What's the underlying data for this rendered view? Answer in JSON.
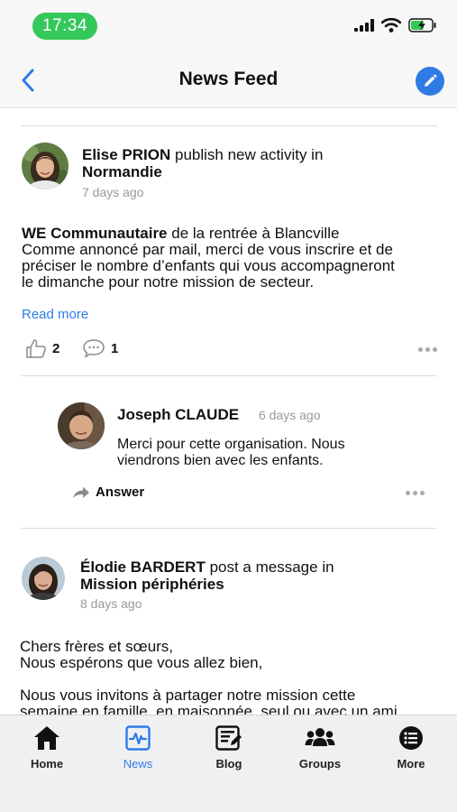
{
  "status_bar": {
    "time": "17:34"
  },
  "nav": {
    "title": "News Feed"
  },
  "posts": [
    {
      "author": "Elise PRION",
      "action": "publish new activity in",
      "group": "Normandie",
      "ago": "7 days ago",
      "title": "WE Communautaire",
      "title_rest": "de la rentrée à Blancville",
      "lines": [
        "Comme annoncé par mail, merci de vous inscrire et de",
        "préciser le nombre d’enfants qui vous accompagneront",
        "le dimanche pour notre mission de secteur."
      ],
      "read_more": "Read more",
      "likes": "2",
      "comments": "1"
    },
    {
      "author": "Élodie BARDERT",
      "action": "post a message in",
      "group": "Mission périphéries",
      "ago": "8 days ago",
      "lines": [
        "Chers frères et sœurs,",
        "Nous espérons que vous allez bien,",
        "Nous vous invitons à partager notre mission cette",
        "semaine en famille, en maisonnée, seul ou avec un ami"
      ]
    }
  ],
  "comment": {
    "author": "Joseph CLAUDE",
    "ago": "6 days ago",
    "lines": [
      "Merci pour cette organisation. Nous",
      "viendrons bien avec les enfants."
    ],
    "answer_label": "Answer"
  },
  "tabs": [
    {
      "label": "Home",
      "icon": "home-icon"
    },
    {
      "label": "News",
      "icon": "news-icon",
      "active": true
    },
    {
      "label": "Blog",
      "icon": "blog-icon"
    },
    {
      "label": "Groups",
      "icon": "groups-icon"
    },
    {
      "label": "More",
      "icon": "more-icon"
    }
  ],
  "colors": {
    "accent": "#2f7be6",
    "time_pill": "#34c759",
    "muted": "#9a9a9a"
  }
}
